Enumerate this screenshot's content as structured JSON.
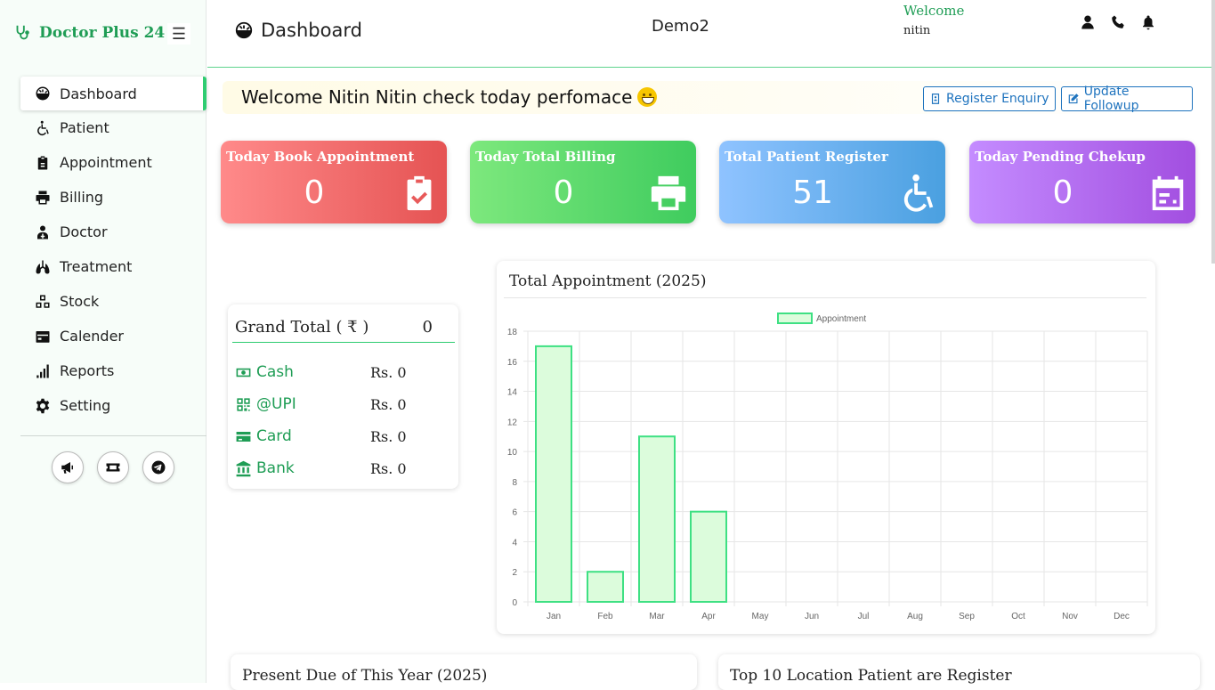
{
  "brand": {
    "name": "Doctor Plus 24"
  },
  "sidebar": {
    "items": [
      {
        "label": "Dashboard",
        "icon": "dashboard-gauge-icon"
      },
      {
        "label": "Patient",
        "icon": "wheelchair-icon"
      },
      {
        "label": "Appointment",
        "icon": "clipboard-icon"
      },
      {
        "label": "Billing",
        "icon": "printer-icon"
      },
      {
        "label": "Doctor",
        "icon": "doctor-icon"
      },
      {
        "label": "Treatment",
        "icon": "lungs-icon"
      },
      {
        "label": "Stock",
        "icon": "boxes-icon"
      },
      {
        "label": "Calender",
        "icon": "calendar-icon"
      },
      {
        "label": "Reports",
        "icon": "bar-chart-icon"
      },
      {
        "label": "Setting",
        "icon": "gear-icon"
      }
    ],
    "footer_icons": [
      "megaphone-icon",
      "ticket-icon",
      "telegram-icon"
    ]
  },
  "header": {
    "title": "Dashboard",
    "clinic": "Demo2",
    "welcome_label": "Welcome",
    "user": "nitin",
    "icons": [
      "user-icon",
      "phone-icon",
      "bell-icon"
    ]
  },
  "banner": {
    "text": "Welcome Nitin Nitin check today perfomace",
    "register_enquiry": "Register Enquiry",
    "update_followup": "Update Followup"
  },
  "stats": [
    {
      "title": "Today Book Appointment",
      "value": "0"
    },
    {
      "title": "Today Total Billing",
      "value": "0"
    },
    {
      "title": "Total Patient Register",
      "value": "51"
    },
    {
      "title": "Today Pending Chekup",
      "value": "0"
    }
  ],
  "grand_total": {
    "label": "Grand Total ( ₹ )",
    "value": "0",
    "rows": [
      {
        "label": "Cash",
        "value": "Rs. 0"
      },
      {
        "label": "@UPI",
        "value": "Rs. 0"
      },
      {
        "label": "Card",
        "value": "Rs. 0"
      },
      {
        "label": "Bank",
        "value": "Rs. 0"
      }
    ]
  },
  "chart_data": {
    "type": "bar",
    "title": "Total Appointment (2025)",
    "categories": [
      "Jan",
      "Feb",
      "Mar",
      "Apr",
      "May",
      "Jun",
      "Jul",
      "Aug",
      "Sep",
      "Oct",
      "Nov",
      "Dec"
    ],
    "series": [
      {
        "name": "Appointment",
        "values": [
          17,
          2,
          11,
          6,
          0,
          0,
          0,
          0,
          0,
          0,
          0,
          0
        ]
      }
    ],
    "ylim": [
      0,
      18
    ],
    "yticks": [
      0,
      2,
      4,
      6,
      8,
      10,
      12,
      14,
      16,
      18
    ],
    "legend": "top-center",
    "grid": true,
    "bar_fill": "#dcfcdc",
    "bar_stroke": "#3ee083"
  },
  "bottom_cards": [
    {
      "title": "Present Due of This Year (2025)"
    },
    {
      "title": "Top 10 Location Patient are Register"
    }
  ],
  "colors": {
    "accent": "#1f9d55",
    "link": "#1e73be"
  }
}
